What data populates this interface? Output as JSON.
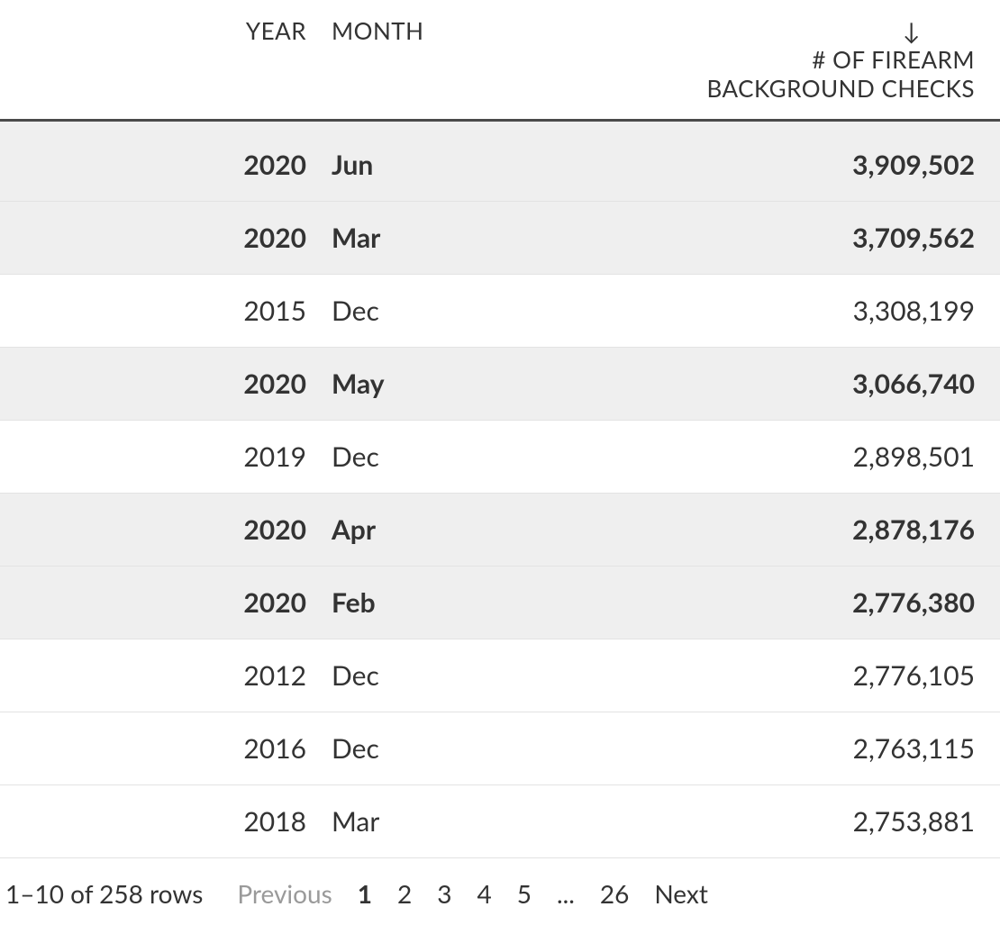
{
  "chart_data": {
    "type": "table",
    "title": "# OF FIREARM BACKGROUND CHECKS",
    "columns": [
      "YEAR",
      "MONTH",
      "# OF FIREARM BACKGROUND CHECKS"
    ],
    "sort": {
      "column": "# OF FIREARM BACKGROUND CHECKS",
      "direction": "desc"
    },
    "rows": [
      {
        "year": 2020,
        "month": "Jun",
        "count": 3909502,
        "highlight": true
      },
      {
        "year": 2020,
        "month": "Mar",
        "count": 3709562,
        "highlight": true
      },
      {
        "year": 2015,
        "month": "Dec",
        "count": 3308199,
        "highlight": false
      },
      {
        "year": 2020,
        "month": "May",
        "count": 3066740,
        "highlight": true
      },
      {
        "year": 2019,
        "month": "Dec",
        "count": 2898501,
        "highlight": false
      },
      {
        "year": 2020,
        "month": "Apr",
        "count": 2878176,
        "highlight": true
      },
      {
        "year": 2020,
        "month": "Feb",
        "count": 2776380,
        "highlight": true
      },
      {
        "year": 2012,
        "month": "Dec",
        "count": 2776105,
        "highlight": false
      },
      {
        "year": 2016,
        "month": "Dec",
        "count": 2763115,
        "highlight": false
      },
      {
        "year": 2018,
        "month": "Mar",
        "count": 2753881,
        "highlight": false
      }
    ]
  },
  "table": {
    "headers": {
      "year": "YEAR",
      "month": "MONTH",
      "count_line1": "# OF FIREARM",
      "count_line2": "BACKGROUND CHECKS",
      "sort_arrow": "↓"
    },
    "rows": [
      {
        "year": "2020",
        "month": "Jun",
        "count": "3,909,502",
        "highlight": true
      },
      {
        "year": "2020",
        "month": "Mar",
        "count": "3,709,562",
        "highlight": true
      },
      {
        "year": "2015",
        "month": "Dec",
        "count": "3,308,199",
        "highlight": false
      },
      {
        "year": "2020",
        "month": "May",
        "count": "3,066,740",
        "highlight": true
      },
      {
        "year": "2019",
        "month": "Dec",
        "count": "2,898,501",
        "highlight": false
      },
      {
        "year": "2020",
        "month": "Apr",
        "count": "2,878,176",
        "highlight": true
      },
      {
        "year": "2020",
        "month": "Feb",
        "count": "2,776,380",
        "highlight": true
      },
      {
        "year": "2012",
        "month": "Dec",
        "count": "2,776,105",
        "highlight": false
      },
      {
        "year": "2016",
        "month": "Dec",
        "count": "2,763,115",
        "highlight": false
      },
      {
        "year": "2018",
        "month": "Mar",
        "count": "2,753,881",
        "highlight": false
      }
    ]
  },
  "pagination": {
    "summary": "1–10 of 258 rows",
    "previous": "Previous",
    "next": "Next",
    "pages": [
      "1",
      "2",
      "3",
      "4",
      "5"
    ],
    "ellipsis": "...",
    "last_page": "26",
    "current": "1"
  }
}
